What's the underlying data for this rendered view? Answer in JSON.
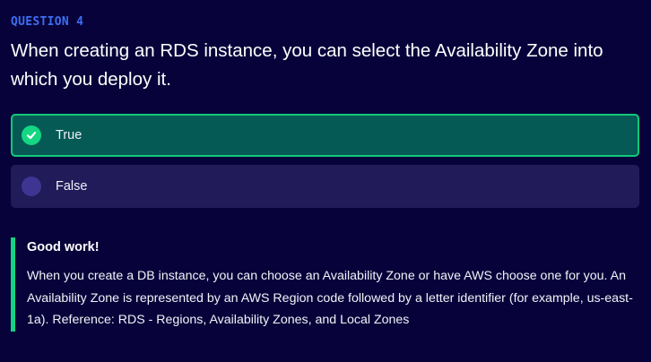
{
  "question": {
    "label": "QUESTION 4",
    "text": "When creating an RDS instance, you can select the Availability Zone into which you deploy it."
  },
  "options": [
    {
      "label": "True",
      "state": "correct-selected",
      "icon": "check-circle-icon"
    },
    {
      "label": "False",
      "state": "unselected",
      "icon": "radio-empty-icon"
    }
  ],
  "feedback": {
    "title": "Good work!",
    "body": "When you create a DB instance, you can choose an Availability Zone or have AWS choose one for you. An Availability Zone is represented by an AWS Region code followed by a letter identifier (for example, us-east-1a). Reference: RDS - Regions, Availability Zones, and Local Zones"
  },
  "colors": {
    "background": "#07033a",
    "accent": "#3d6ef2",
    "correct": "#12c87c",
    "correct_bg": "#055a55",
    "option_bg": "#211b5a"
  }
}
